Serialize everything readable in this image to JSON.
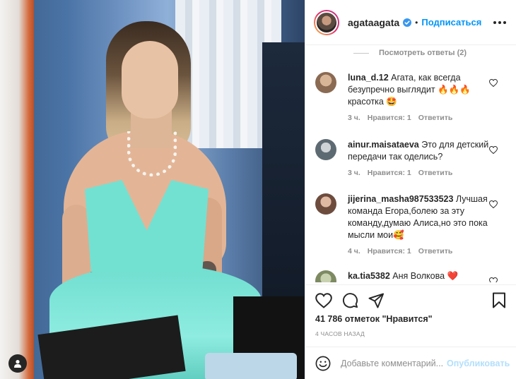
{
  "post": {
    "author": {
      "username": "agataagata",
      "verified": true
    },
    "follow_label": "Подписаться",
    "separator": "•",
    "photo": {
      "user_tag_icon": "user-icon"
    }
  },
  "comments": {
    "view_replies": "Посмотреть ответы (2)",
    "items": [
      {
        "username": "luna_d.12",
        "text": "Агата, как всегда безупречно выглядит 🔥🔥🔥 красотка 🤩",
        "time": "3 ч.",
        "likes": "Нравится: 1",
        "reply": "Ответить"
      },
      {
        "username": "ainur.maisataeva",
        "text": "Это для детский передачи так оделись?",
        "time": "3 ч.",
        "likes": "Нравится: 1",
        "reply": "Ответить"
      },
      {
        "username": "jijerina_masha987533523",
        "text": "Лучшая команда Егора,болею за эту команду,думаю Алиса,но это пока мысли мои🥰",
        "time": "4 ч.",
        "likes": "Нравится: 1",
        "reply": "Ответить"
      },
      {
        "username": "ka.tia5382",
        "text": "Аня Волкова ❤️",
        "time": "",
        "likes": "",
        "reply": ""
      }
    ]
  },
  "stats": {
    "likes_text": "41 786 отметок \"Нравится\"",
    "time_ago": "4 ЧАСОВ НАЗАД"
  },
  "add_comment": {
    "placeholder": "Добавьте комментарий...",
    "publish_label": "Опубликовать"
  },
  "icons": {
    "like": "heart-icon",
    "comment": "comment-icon",
    "share": "share-icon",
    "save": "bookmark-icon",
    "emoji": "emoji-icon",
    "more": "more-icon",
    "verified": "verified-badge-icon"
  },
  "colors": {
    "accent": "#0095f6",
    "publish_disabled": "#b2dffc",
    "muted": "#8e8e8e",
    "text": "#262626"
  }
}
